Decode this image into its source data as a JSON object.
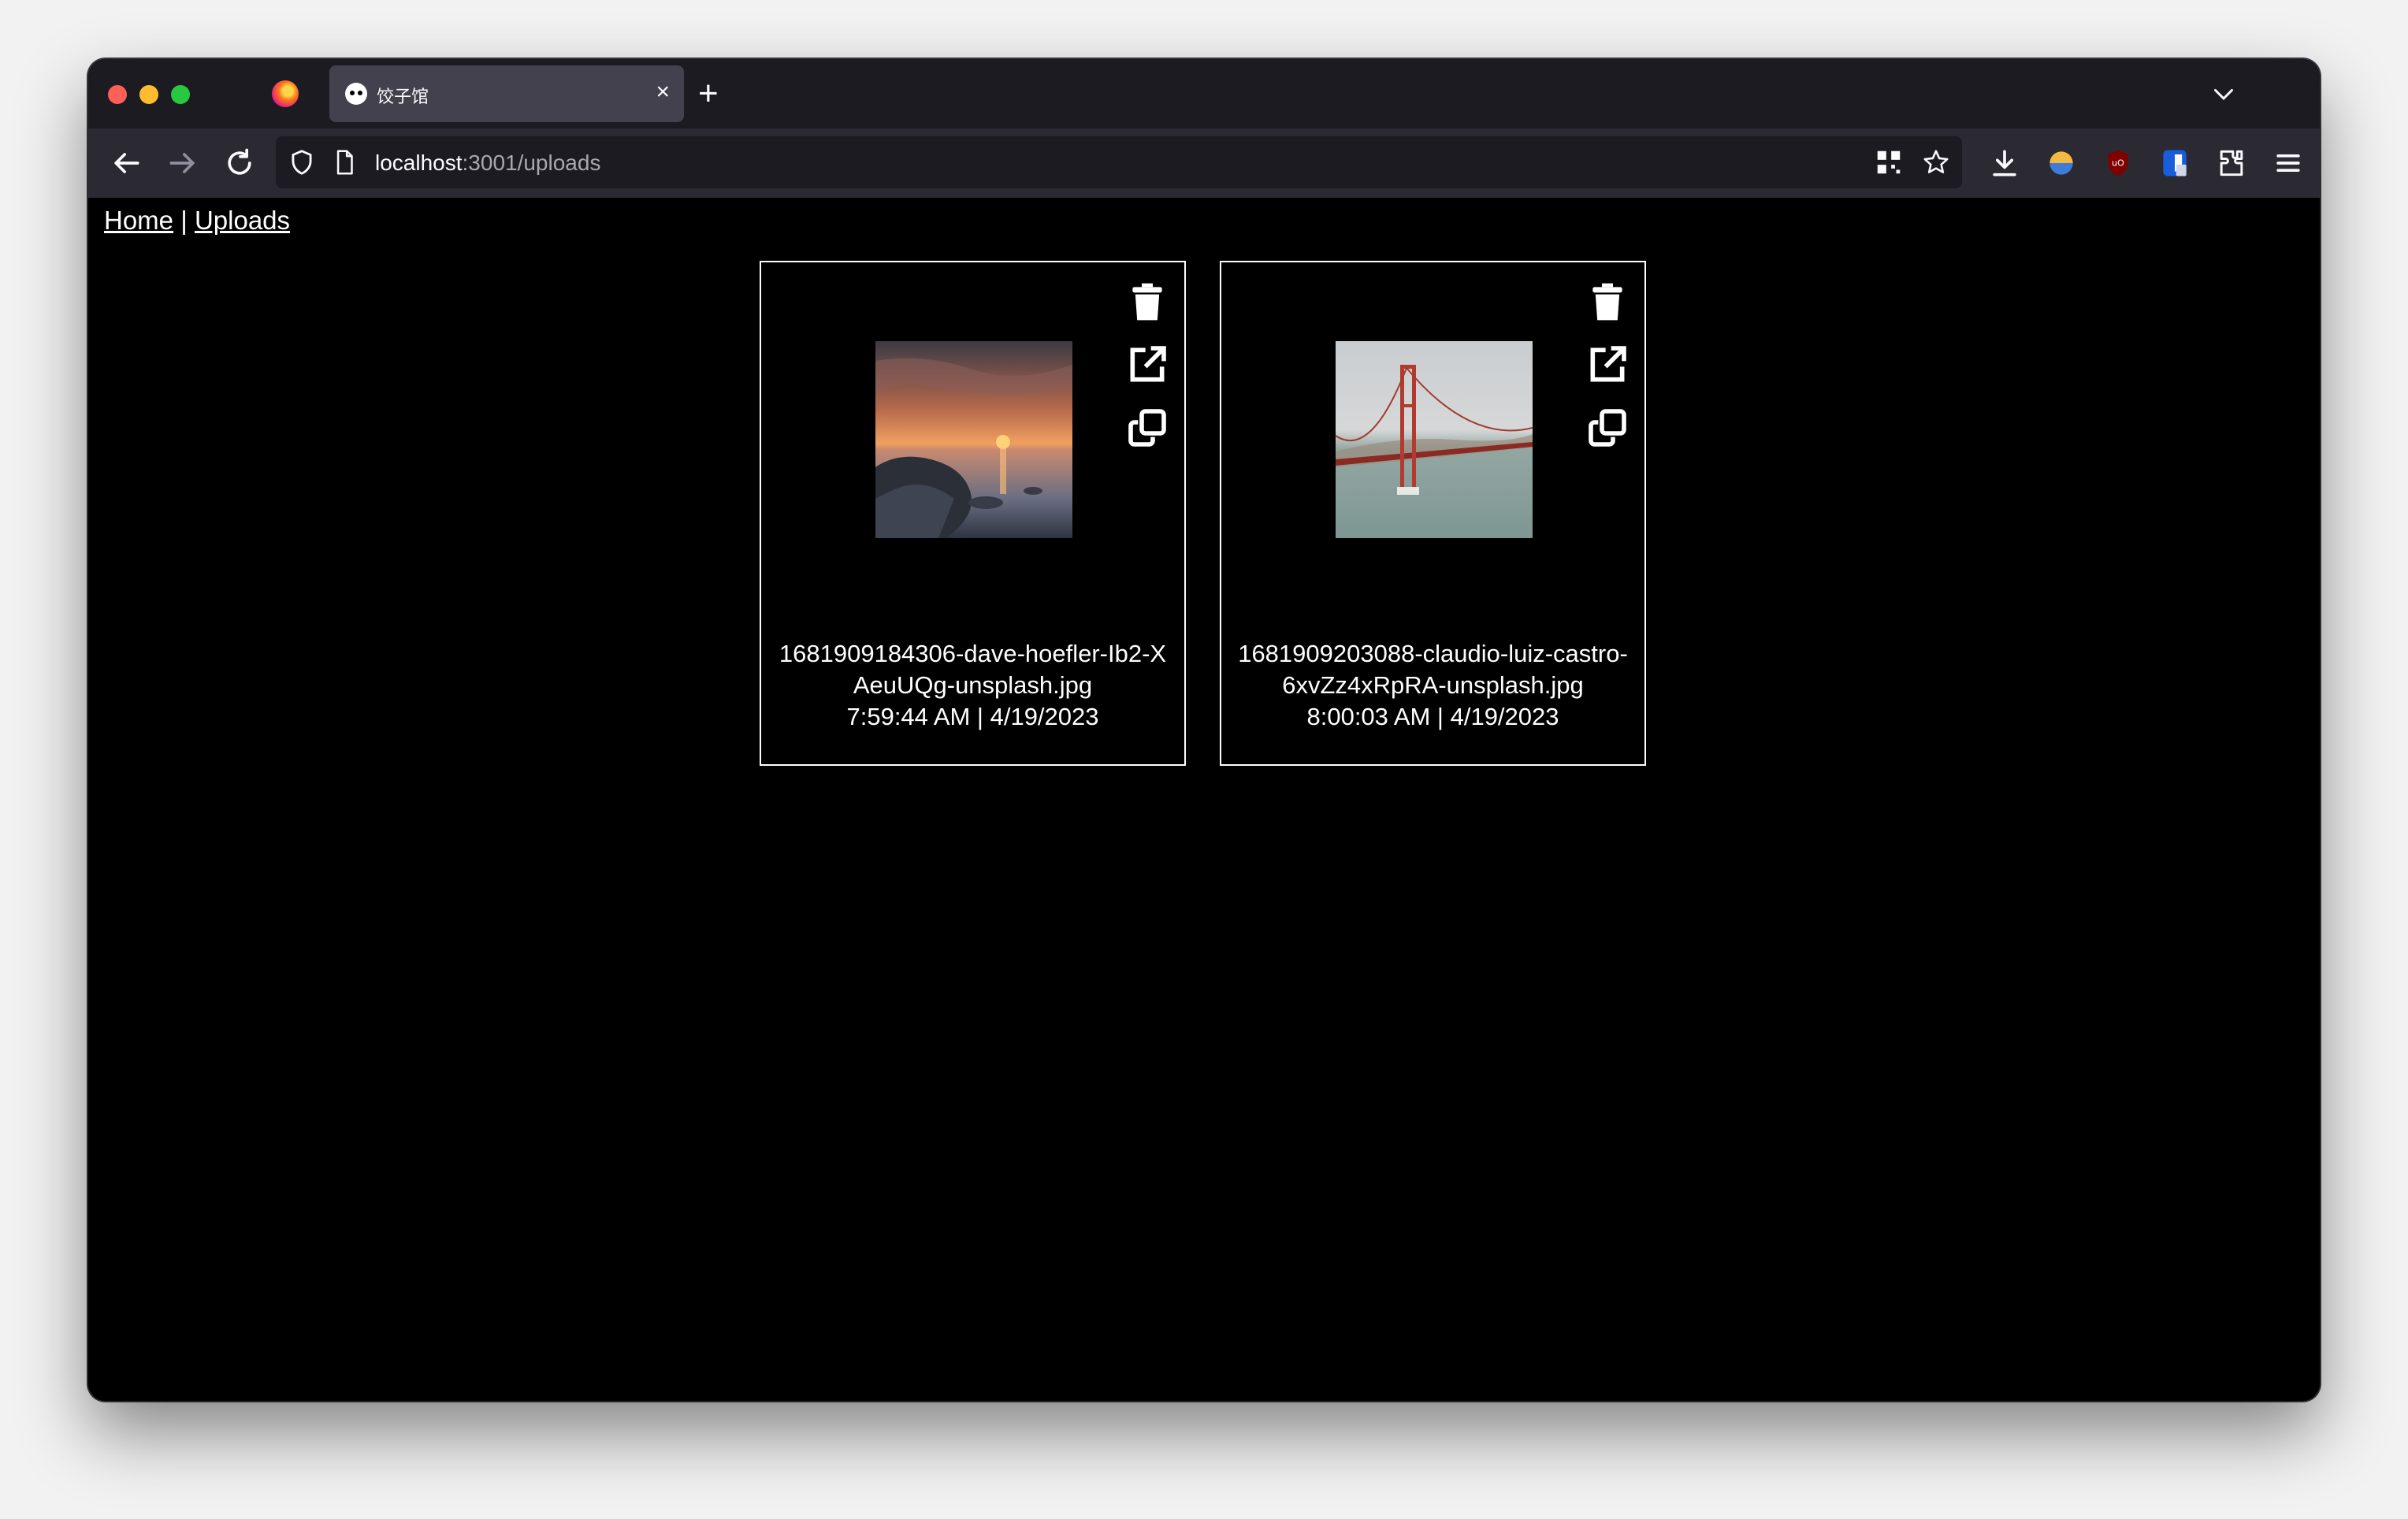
{
  "browser": {
    "tab": {
      "title": "饺子馆",
      "close": "×"
    },
    "new_tab": "+",
    "url": {
      "host": "localhost",
      "path": ":3001/uploads"
    }
  },
  "nav": {
    "home": "Home",
    "separator": "|",
    "uploads": "Uploads"
  },
  "uploads": [
    {
      "filename": "1681909184306-dave-hoefler-Ib2-XAeuUQg-unsplash.jpg",
      "timestamp": "7:59:44 AM | 4/19/2023",
      "thumbnail": "sunset-lake-rocks"
    },
    {
      "filename": "1681909203088-claudio-luiz-castro-6xvZz4xRpRA-unsplash.jpg",
      "timestamp": "8:00:03 AM | 4/19/2023",
      "thumbnail": "red-suspension-bridge"
    }
  ],
  "icons": {
    "delete": "trash-icon",
    "open": "external-link-icon",
    "copy": "copy-icon"
  }
}
